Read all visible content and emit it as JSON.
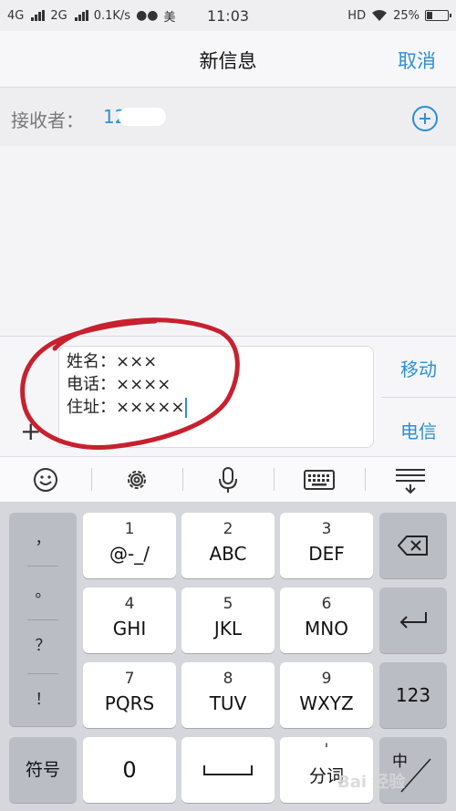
{
  "status_bar": {
    "network1": "4G",
    "network2": "2G",
    "speed": "0.1K/s",
    "carrier": "美",
    "time": "11:03",
    "hd": "HD",
    "battery": "25%"
  },
  "header": {
    "title": "新信息",
    "cancel_label": "取消"
  },
  "recipient": {
    "label": "接收者：",
    "value": "12"
  },
  "message": {
    "lines": [
      "姓名：×××",
      "电话：××××",
      "住址：×××××"
    ]
  },
  "sim": {
    "sim1_label": "移动",
    "sim2_label": "电信"
  },
  "toolbar": {
    "icons": [
      "smiley-icon",
      "gear-icon",
      "microphone-icon",
      "keyboard-icon",
      "collapse-keyboard-icon"
    ]
  },
  "keyboard": {
    "punctuation": [
      "，",
      "。",
      "？",
      "！"
    ],
    "keys": [
      {
        "num": "1",
        "letters": "@-_/"
      },
      {
        "num": "2",
        "letters": "ABC"
      },
      {
        "num": "3",
        "letters": "DEF"
      },
      {
        "num": "4",
        "letters": "GHI"
      },
      {
        "num": "5",
        "letters": "JKL"
      },
      {
        "num": "6",
        "letters": "MNO"
      },
      {
        "num": "7",
        "letters": "PQRS"
      },
      {
        "num": "8",
        "letters": "TUV"
      },
      {
        "num": "9",
        "letters": "WXYZ"
      }
    ],
    "numeric_label": "123",
    "symbols_label": "符号",
    "zero_label": "0",
    "fenci_top": "'",
    "fenci_label": "分词",
    "lang_label": "中",
    "space_icon": "space-icon",
    "backspace_icon": "backspace-icon",
    "enter_icon": "enter-icon"
  },
  "watermark": "Bai 经验",
  "colors": {
    "accent": "#2c8fd6",
    "annotation": "#c8202e"
  }
}
